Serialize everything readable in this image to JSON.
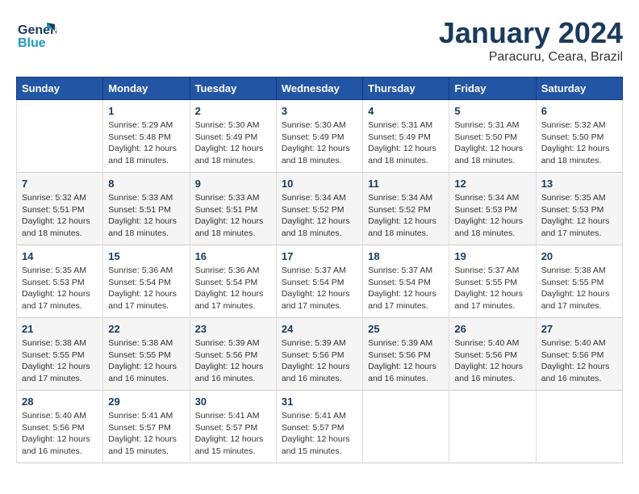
{
  "logo": {
    "line1": "General",
    "line2": "Blue"
  },
  "title": "January 2024",
  "subtitle": "Paracuru, Ceara, Brazil",
  "days_of_week": [
    "Sunday",
    "Monday",
    "Tuesday",
    "Wednesday",
    "Thursday",
    "Friday",
    "Saturday"
  ],
  "weeks": [
    [
      {
        "day": "",
        "info": ""
      },
      {
        "day": "1",
        "info": "Sunrise: 5:29 AM\nSunset: 5:48 PM\nDaylight: 12 hours\nand 18 minutes."
      },
      {
        "day": "2",
        "info": "Sunrise: 5:30 AM\nSunset: 5:49 PM\nDaylight: 12 hours\nand 18 minutes."
      },
      {
        "day": "3",
        "info": "Sunrise: 5:30 AM\nSunset: 5:49 PM\nDaylight: 12 hours\nand 18 minutes."
      },
      {
        "day": "4",
        "info": "Sunrise: 5:31 AM\nSunset: 5:49 PM\nDaylight: 12 hours\nand 18 minutes."
      },
      {
        "day": "5",
        "info": "Sunrise: 5:31 AM\nSunset: 5:50 PM\nDaylight: 12 hours\nand 18 minutes."
      },
      {
        "day": "6",
        "info": "Sunrise: 5:32 AM\nSunset: 5:50 PM\nDaylight: 12 hours\nand 18 minutes."
      }
    ],
    [
      {
        "day": "7",
        "info": "Sunrise: 5:32 AM\nSunset: 5:51 PM\nDaylight: 12 hours\nand 18 minutes."
      },
      {
        "day": "8",
        "info": "Sunrise: 5:33 AM\nSunset: 5:51 PM\nDaylight: 12 hours\nand 18 minutes."
      },
      {
        "day": "9",
        "info": "Sunrise: 5:33 AM\nSunset: 5:51 PM\nDaylight: 12 hours\nand 18 minutes."
      },
      {
        "day": "10",
        "info": "Sunrise: 5:34 AM\nSunset: 5:52 PM\nDaylight: 12 hours\nand 18 minutes."
      },
      {
        "day": "11",
        "info": "Sunrise: 5:34 AM\nSunset: 5:52 PM\nDaylight: 12 hours\nand 18 minutes."
      },
      {
        "day": "12",
        "info": "Sunrise: 5:34 AM\nSunset: 5:53 PM\nDaylight: 12 hours\nand 18 minutes."
      },
      {
        "day": "13",
        "info": "Sunrise: 5:35 AM\nSunset: 5:53 PM\nDaylight: 12 hours\nand 17 minutes."
      }
    ],
    [
      {
        "day": "14",
        "info": "Sunrise: 5:35 AM\nSunset: 5:53 PM\nDaylight: 12 hours\nand 17 minutes."
      },
      {
        "day": "15",
        "info": "Sunrise: 5:36 AM\nSunset: 5:54 PM\nDaylight: 12 hours\nand 17 minutes."
      },
      {
        "day": "16",
        "info": "Sunrise: 5:36 AM\nSunset: 5:54 PM\nDaylight: 12 hours\nand 17 minutes."
      },
      {
        "day": "17",
        "info": "Sunrise: 5:37 AM\nSunset: 5:54 PM\nDaylight: 12 hours\nand 17 minutes."
      },
      {
        "day": "18",
        "info": "Sunrise: 5:37 AM\nSunset: 5:54 PM\nDaylight: 12 hours\nand 17 minutes."
      },
      {
        "day": "19",
        "info": "Sunrise: 5:37 AM\nSunset: 5:55 PM\nDaylight: 12 hours\nand 17 minutes."
      },
      {
        "day": "20",
        "info": "Sunrise: 5:38 AM\nSunset: 5:55 PM\nDaylight: 12 hours\nand 17 minutes."
      }
    ],
    [
      {
        "day": "21",
        "info": "Sunrise: 5:38 AM\nSunset: 5:55 PM\nDaylight: 12 hours\nand 17 minutes."
      },
      {
        "day": "22",
        "info": "Sunrise: 5:38 AM\nSunset: 5:55 PM\nDaylight: 12 hours\nand 16 minutes."
      },
      {
        "day": "23",
        "info": "Sunrise: 5:39 AM\nSunset: 5:56 PM\nDaylight: 12 hours\nand 16 minutes."
      },
      {
        "day": "24",
        "info": "Sunrise: 5:39 AM\nSunset: 5:56 PM\nDaylight: 12 hours\nand 16 minutes."
      },
      {
        "day": "25",
        "info": "Sunrise: 5:39 AM\nSunset: 5:56 PM\nDaylight: 12 hours\nand 16 minutes."
      },
      {
        "day": "26",
        "info": "Sunrise: 5:40 AM\nSunset: 5:56 PM\nDaylight: 12 hours\nand 16 minutes."
      },
      {
        "day": "27",
        "info": "Sunrise: 5:40 AM\nSunset: 5:56 PM\nDaylight: 12 hours\nand 16 minutes."
      }
    ],
    [
      {
        "day": "28",
        "info": "Sunrise: 5:40 AM\nSunset: 5:56 PM\nDaylight: 12 hours\nand 16 minutes."
      },
      {
        "day": "29",
        "info": "Sunrise: 5:41 AM\nSunset: 5:57 PM\nDaylight: 12 hours\nand 15 minutes."
      },
      {
        "day": "30",
        "info": "Sunrise: 5:41 AM\nSunset: 5:57 PM\nDaylight: 12 hours\nand 15 minutes."
      },
      {
        "day": "31",
        "info": "Sunrise: 5:41 AM\nSunset: 5:57 PM\nDaylight: 12 hours\nand 15 minutes."
      },
      {
        "day": "",
        "info": ""
      },
      {
        "day": "",
        "info": ""
      },
      {
        "day": "",
        "info": ""
      }
    ]
  ]
}
